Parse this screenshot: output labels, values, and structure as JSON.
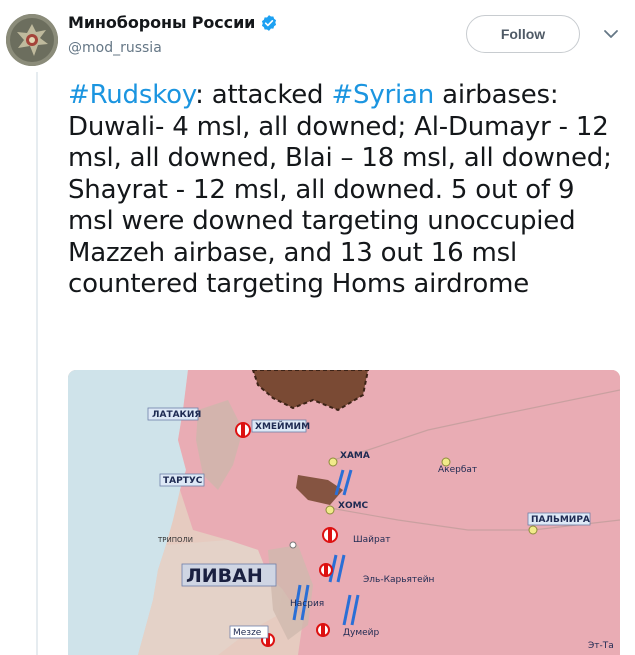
{
  "account": {
    "display_name": "Минобороны России",
    "handle": "@mod_russia"
  },
  "follow_label": "Follow",
  "tweet": {
    "segments": [
      {
        "text": "#Rudskoy",
        "type": "hashtag"
      },
      {
        "text": ": attacked ",
        "type": "text"
      },
      {
        "text": "#Syrian",
        "type": "hashtag"
      },
      {
        "text": " airbases: Duwali- 4 msl, all downed; Al-Dumayr - 12 msl, all downed, Blai – 18 msl, all downed; Shayrat - 12 msl, all downed. 5 out of 9 msl were downed targeting unoccupied Mazzeh airbase, and 13 out 16 msl countered targeting Homs airdrome",
        "type": "text"
      }
    ]
  },
  "map": {
    "labels": {
      "latakia": "ЛАТАКИЯ",
      "hmeimim": "ХМЕЙМИМ",
      "tartus": "ТАРТУС",
      "hama": "ХАМА",
      "akerbat": "Акербат",
      "homs": "ХОМС",
      "palmyra": "ПАЛЬМИРА",
      "tripoli": "ТРИПОЛИ",
      "shayrat": "Шайрат",
      "lebanon": "ЛИВАН",
      "el_karyatein": "Эль-Карьятейн",
      "nasriya": "Насрия",
      "mezze": "Мезze",
      "dumayr": "Думейр",
      "et_tiyas": "Эт-Та"
    },
    "colors": {
      "land": "#e6cbc0",
      "territory": "#e9a7b2",
      "coast_sea": "#cfe3ea",
      "militant_zone": "#7a4a34",
      "missile": "#2a6fd6"
    }
  }
}
